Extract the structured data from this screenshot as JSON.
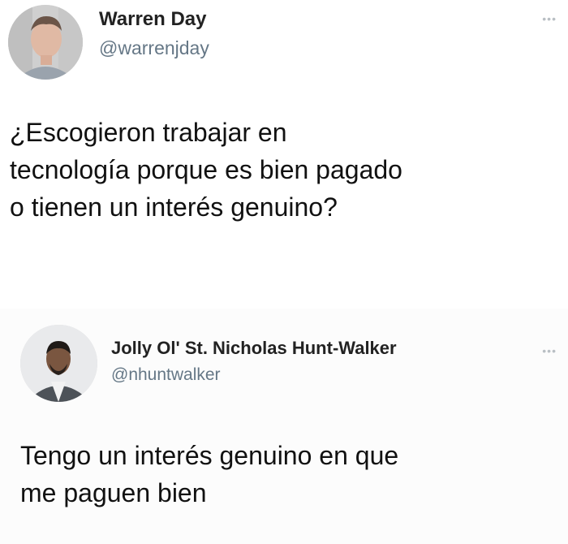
{
  "tweets": [
    {
      "author": {
        "name": "Warren Day",
        "handle": "@warrenjday"
      },
      "text_lines": [
        "¿Escogieron trabajar en",
        "tecnología porque es bien pagado",
        "o tienen un interés genuino?"
      ],
      "more_icon": "more-options-icon"
    },
    {
      "author": {
        "name": "Jolly Ol' St. Nicholas Hunt-Walker",
        "handle": "@nhuntwalker"
      },
      "text_lines": [
        "Tengo un interés genuino en que",
        "me paguen bien"
      ],
      "more_icon": "more-options-icon"
    }
  ]
}
